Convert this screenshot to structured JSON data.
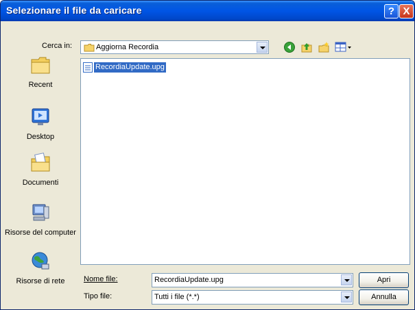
{
  "window": {
    "title": "Selezionare il file da caricare"
  },
  "title_buttons": {
    "help": "?",
    "close": "X"
  },
  "look_in": {
    "label": "Cerca in:",
    "value": "Aggiorna Recordia"
  },
  "toolbar": {
    "icons": [
      "back-icon",
      "up-folder-icon",
      "new-folder-icon",
      "view-menu-icon"
    ]
  },
  "places": [
    {
      "id": "recent",
      "label": "Recent",
      "icon": "recent-folder-icon"
    },
    {
      "id": "desktop",
      "label": "Desktop",
      "icon": "desktop-icon"
    },
    {
      "id": "documents",
      "label": "Documenti",
      "icon": "documents-icon"
    },
    {
      "id": "computer",
      "label": "Risorse del computer",
      "icon": "computer-icon"
    },
    {
      "id": "network",
      "label": "Risorse di rete",
      "icon": "network-icon"
    }
  ],
  "files": [
    {
      "name": "RecordiaUpdate.upg",
      "selected": true
    }
  ],
  "filename": {
    "label": "Nome file:",
    "value": "RecordiaUpdate.upg"
  },
  "filetype": {
    "label": "Tipo file:",
    "value": "Tutti i file (*.*)"
  },
  "buttons": {
    "open": "Apri",
    "cancel": "Annulla"
  },
  "colors": {
    "titlebar": "#0055e5",
    "selection": "#316ac5",
    "dialog_bg": "#ece9d8"
  }
}
